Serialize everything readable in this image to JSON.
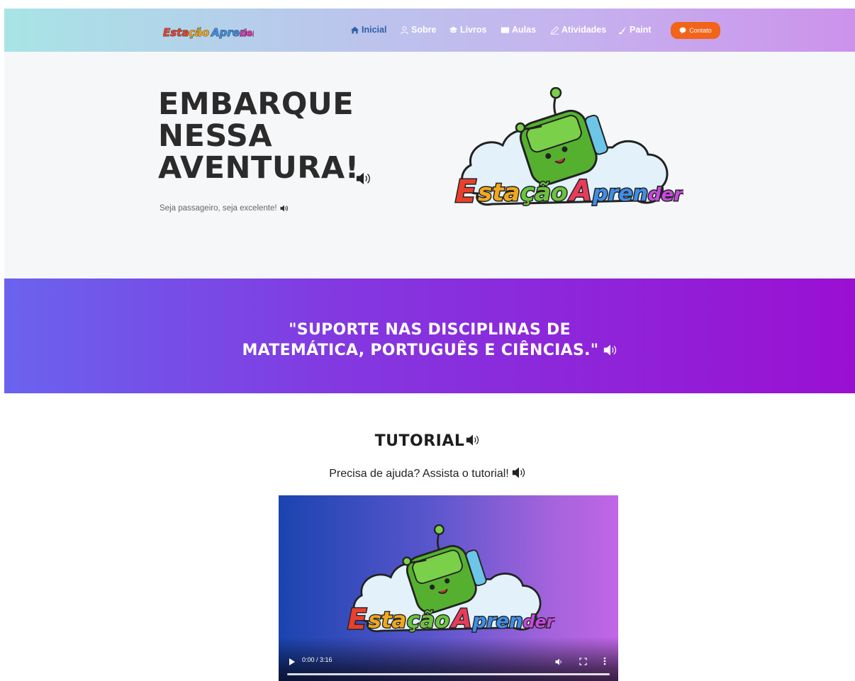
{
  "nav": {
    "brand": "EstaçãoAprender",
    "items": [
      {
        "label": "Inicial",
        "icon": "home-icon",
        "active": true
      },
      {
        "label": "Sobre",
        "icon": "user-icon",
        "active": false
      },
      {
        "label": "Livros",
        "icon": "book-icon",
        "active": false
      },
      {
        "label": "Aulas",
        "icon": "video-icon",
        "active": false
      },
      {
        "label": "Atividades",
        "icon": "pencil-icon",
        "active": false
      },
      {
        "label": "Paint",
        "icon": "brush-icon",
        "active": false
      }
    ],
    "contact_label": "Contato"
  },
  "hero": {
    "title_lines": [
      "EMBARQUE",
      "NESSA",
      "AVENTURA!"
    ],
    "subtitle": "Seja passageiro, seja excelente!",
    "logo_text": "EstaçãoAprender"
  },
  "quote": {
    "lines": [
      "\"SUPORTE NAS DISCIPLINAS DE",
      "MATEMÁTICA, PORTUGUÊS E CIÊNCIAS.\""
    ]
  },
  "tutorial": {
    "title": "TUTORIAL",
    "subtitle": "Precisa de ajuda? Assista o tutorial!",
    "video_time": "0:00 / 3:16"
  },
  "colors": {
    "nav_active": "#2f5ea6",
    "contact_button": "#f2641a",
    "quote_band_start": "#6a63ee",
    "quote_band_end": "#9a10d2"
  }
}
